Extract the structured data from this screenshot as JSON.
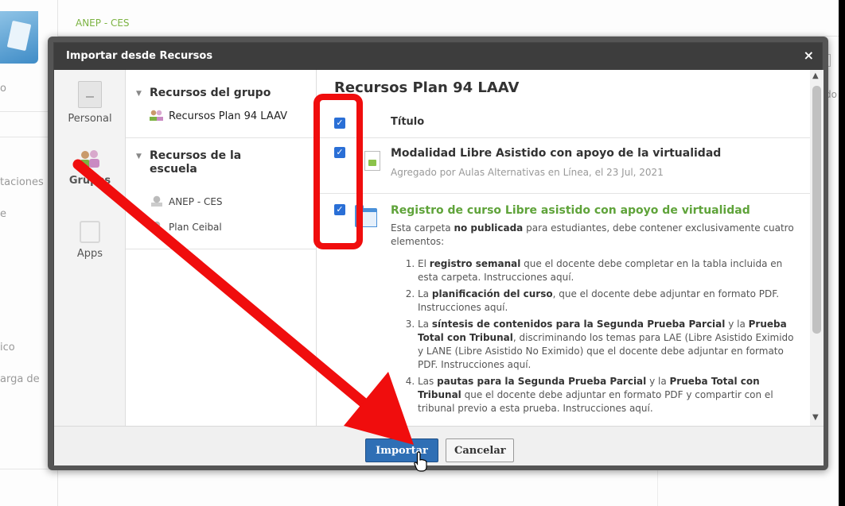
{
  "background": {
    "school_label": "ANEP - CES",
    "left_fragments": [
      "o",
      "taciones",
      "e",
      "ico",
      "arga de"
    ],
    "right_fragment": "dado"
  },
  "dialog": {
    "title": "Importar desde Recursos",
    "close_glyph": "×",
    "categories": [
      {
        "label": "Personal",
        "icon": "personal-icon"
      },
      {
        "label": "Grupos",
        "icon": "group-icon"
      },
      {
        "label": "Apps",
        "icon": "apps-icon"
      }
    ],
    "tree": {
      "group_heading": "Recursos del grupo",
      "group_items": [
        "Recursos Plan 94 LAAV"
      ],
      "school_heading": "Recursos de la escuela",
      "school_items": [
        "ANEP - CES",
        "Plan Ceibal"
      ]
    },
    "content": {
      "title": "Recursos Plan 94 LAAV",
      "column_header": "Título",
      "check_glyph": "✓",
      "rows": [
        {
          "title": "Modalidad Libre Asistido con apoyo de la virtualidad",
          "meta": "Agregado por Aulas Alternativas en Línea, el 23 Jul, 2021",
          "checked": true,
          "icon": "file-icon"
        },
        {
          "title": "Registro de curso Libre asistido con apoyo de virtualidad",
          "desc_pre": "Esta carpeta ",
          "desc_bold": "no publicada",
          "desc_post": " para estudiantes, debe contener exclusivamente cuatro elementos:",
          "checked": true,
          "icon": "folder-icon",
          "list": [
            {
              "a": "El ",
              "b": "registro semanal",
              "c": " que el docente debe completar en la tabla incluida en esta carpeta. Instrucciones aquí."
            },
            {
              "a": "La ",
              "b": "planificación del curso",
              "c": ", que el docente debe adjuntar en formato PDF. Instrucciones aquí."
            },
            {
              "a": "La ",
              "b": "síntesis de contenidos para la Segunda Prueba Parcial",
              "c": " y la ",
              "d": "Prueba Total con Tribunal",
              "e": ", discriminando los temas para LAE (Libre Asistido Eximido y LANE (Libre Asistido No Eximido) que el docente debe adjuntar en formato PDF. Instrucciones aquí."
            },
            {
              "a": "Las ",
              "b": "pautas para la Segunda Prueba Parcial",
              "c": " y la ",
              "d": "Prueba Total con Tribunal",
              "e": " que el docente debe adjuntar en formato PDF y compartir con el tribunal previo a esta prueba. Instrucciones aquí."
            }
          ]
        }
      ],
      "header_checked": true
    },
    "footer": {
      "import_label": "Importar",
      "cancel_label": "Cancelar"
    }
  },
  "colors": {
    "primary_button": "#2f6fb5",
    "checkbox": "#2a6fd6",
    "annotation_red": "#f00d0d",
    "folder_title_green": "#5fa33a"
  }
}
